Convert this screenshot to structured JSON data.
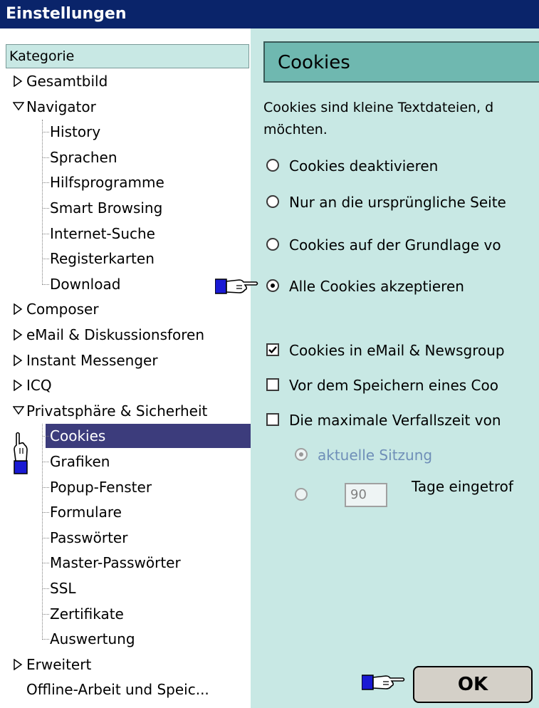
{
  "window": {
    "title": "Einstellungen"
  },
  "tree": {
    "header": "Kategorie",
    "items": [
      {
        "label": "Gesamtbild",
        "level": 0,
        "expanded": false
      },
      {
        "label": "Navigator",
        "level": 0,
        "expanded": true
      },
      {
        "label": "History",
        "level": 1
      },
      {
        "label": "Sprachen",
        "level": 1
      },
      {
        "label": "Hilfsprogramme",
        "level": 1
      },
      {
        "label": "Smart Browsing",
        "level": 1
      },
      {
        "label": "Internet-Suche",
        "level": 1
      },
      {
        "label": "Registerkarten",
        "level": 1
      },
      {
        "label": "Download",
        "level": 1
      },
      {
        "label": "Composer",
        "level": 0,
        "expanded": false
      },
      {
        "label": "eMail & Diskussionsforen",
        "level": 0,
        "expanded": false
      },
      {
        "label": "Instant Messenger",
        "level": 0,
        "expanded": false
      },
      {
        "label": "ICQ",
        "level": 0,
        "expanded": false
      },
      {
        "label": "Privatsphäre & Sicherheit",
        "level": 0,
        "expanded": true
      },
      {
        "label": "Cookies",
        "level": 1,
        "selected": true
      },
      {
        "label": "Grafiken",
        "level": 1
      },
      {
        "label": "Popup-Fenster",
        "level": 1
      },
      {
        "label": "Formulare",
        "level": 1
      },
      {
        "label": "Passwörter",
        "level": 1
      },
      {
        "label": "Master-Passwörter",
        "level": 1
      },
      {
        "label": "SSL",
        "level": 1
      },
      {
        "label": "Zertifikate",
        "level": 1
      },
      {
        "label": "Auswertung",
        "level": 1
      },
      {
        "label": "Erweitert",
        "level": 0,
        "expanded": false
      },
      {
        "label": "Offline-Arbeit und Speic...",
        "level": 0,
        "expanded": null
      }
    ]
  },
  "panel": {
    "title": "Cookies",
    "description_line1": "Cookies sind kleine Textdateien, d",
    "description_line2": "möchten.",
    "radios": [
      {
        "label": "Cookies deaktivieren",
        "checked": false
      },
      {
        "label": "Nur an die ursprüngliche Seite",
        "checked": false
      },
      {
        "label": "Cookies auf der Grundlage vo",
        "checked": false
      },
      {
        "label": "Alle Cookies akzeptieren",
        "checked": true
      }
    ],
    "checkboxes": [
      {
        "label": "Cookies in eMail & Newsgroup",
        "checked": true
      },
      {
        "label": "Vor dem Speichern eines Coo",
        "checked": false
      },
      {
        "label": "Die maximale Verfallszeit von",
        "checked": false
      }
    ],
    "lifetime": {
      "session_label": "aktuelle Sitzung",
      "days_value": "90",
      "days_label": "Tage eingetrof"
    },
    "ok_label": "OK"
  },
  "colors": {
    "titlebar": "#0a246a",
    "panel_bg": "#c8e8e4",
    "panel_head": "#6fb8b0",
    "selection": "#3c3c7c"
  }
}
